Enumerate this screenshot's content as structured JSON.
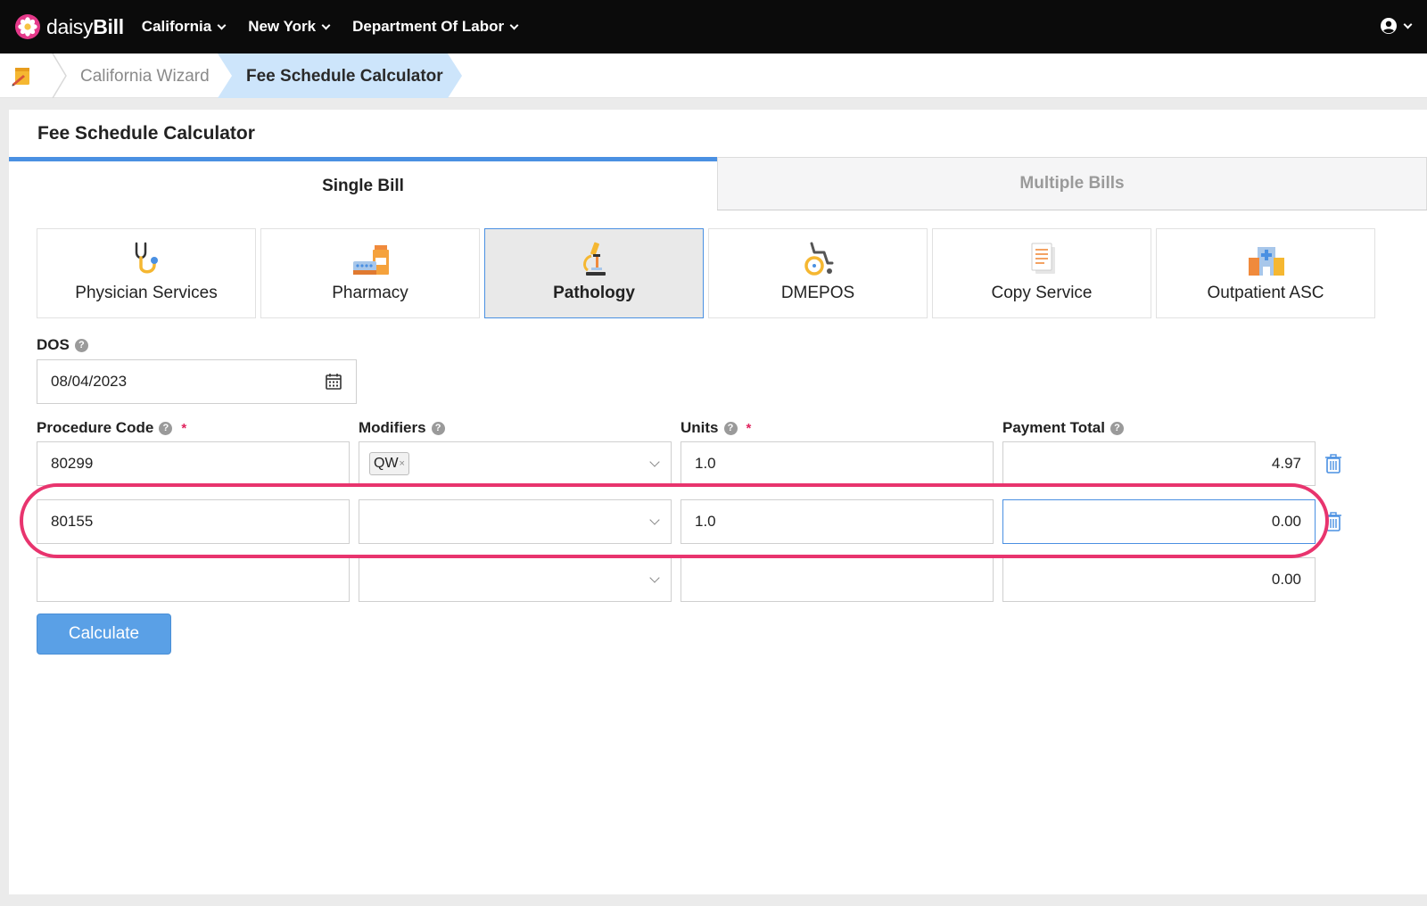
{
  "brand": {
    "name_light": "daisy",
    "name_bold": "Bill"
  },
  "nav": {
    "items": [
      {
        "label": "California"
      },
      {
        "label": "New York"
      },
      {
        "label": "Department Of Labor"
      }
    ]
  },
  "breadcrumb": {
    "items": [
      "California Wizard",
      "Fee Schedule Calculator"
    ]
  },
  "card": {
    "title": "Fee Schedule Calculator"
  },
  "tabs": [
    {
      "label": "Single Bill",
      "active": true
    },
    {
      "label": "Multiple Bills",
      "active": false
    }
  ],
  "categories": [
    {
      "label": "Physician Services",
      "icon": "stethoscope-icon"
    },
    {
      "label": "Pharmacy",
      "icon": "pharmacy-icon"
    },
    {
      "label": "Pathology",
      "icon": "microscope-icon",
      "active": true
    },
    {
      "label": "DMEPOS",
      "icon": "wheelchair-icon"
    },
    {
      "label": "Copy Service",
      "icon": "document-icon"
    },
    {
      "label": "Outpatient ASC",
      "icon": "hospital-icon"
    }
  ],
  "form": {
    "dos_label": "DOS",
    "dos_value": "08/04/2023",
    "help_glyph": "?",
    "required_mark": "*",
    "columns": {
      "procedure_code": "Procedure Code",
      "modifiers": "Modifiers",
      "units": "Units",
      "payment_total": "Payment Total"
    },
    "rows": [
      {
        "procedure_code": "80299",
        "modifier_tag": "QW",
        "units": "1.0",
        "payment_total": "4.97"
      },
      {
        "procedure_code": "80155",
        "modifier_tag": "",
        "units": "1.0",
        "payment_total": "0.00"
      },
      {
        "procedure_code": "",
        "modifier_tag": "",
        "units": "",
        "payment_total": "0.00"
      }
    ],
    "tag_remove": "×",
    "calculate_label": "Calculate"
  },
  "colors": {
    "accent": "#4a90e2",
    "highlight": "#e8346e",
    "button": "#5aa0e6"
  }
}
